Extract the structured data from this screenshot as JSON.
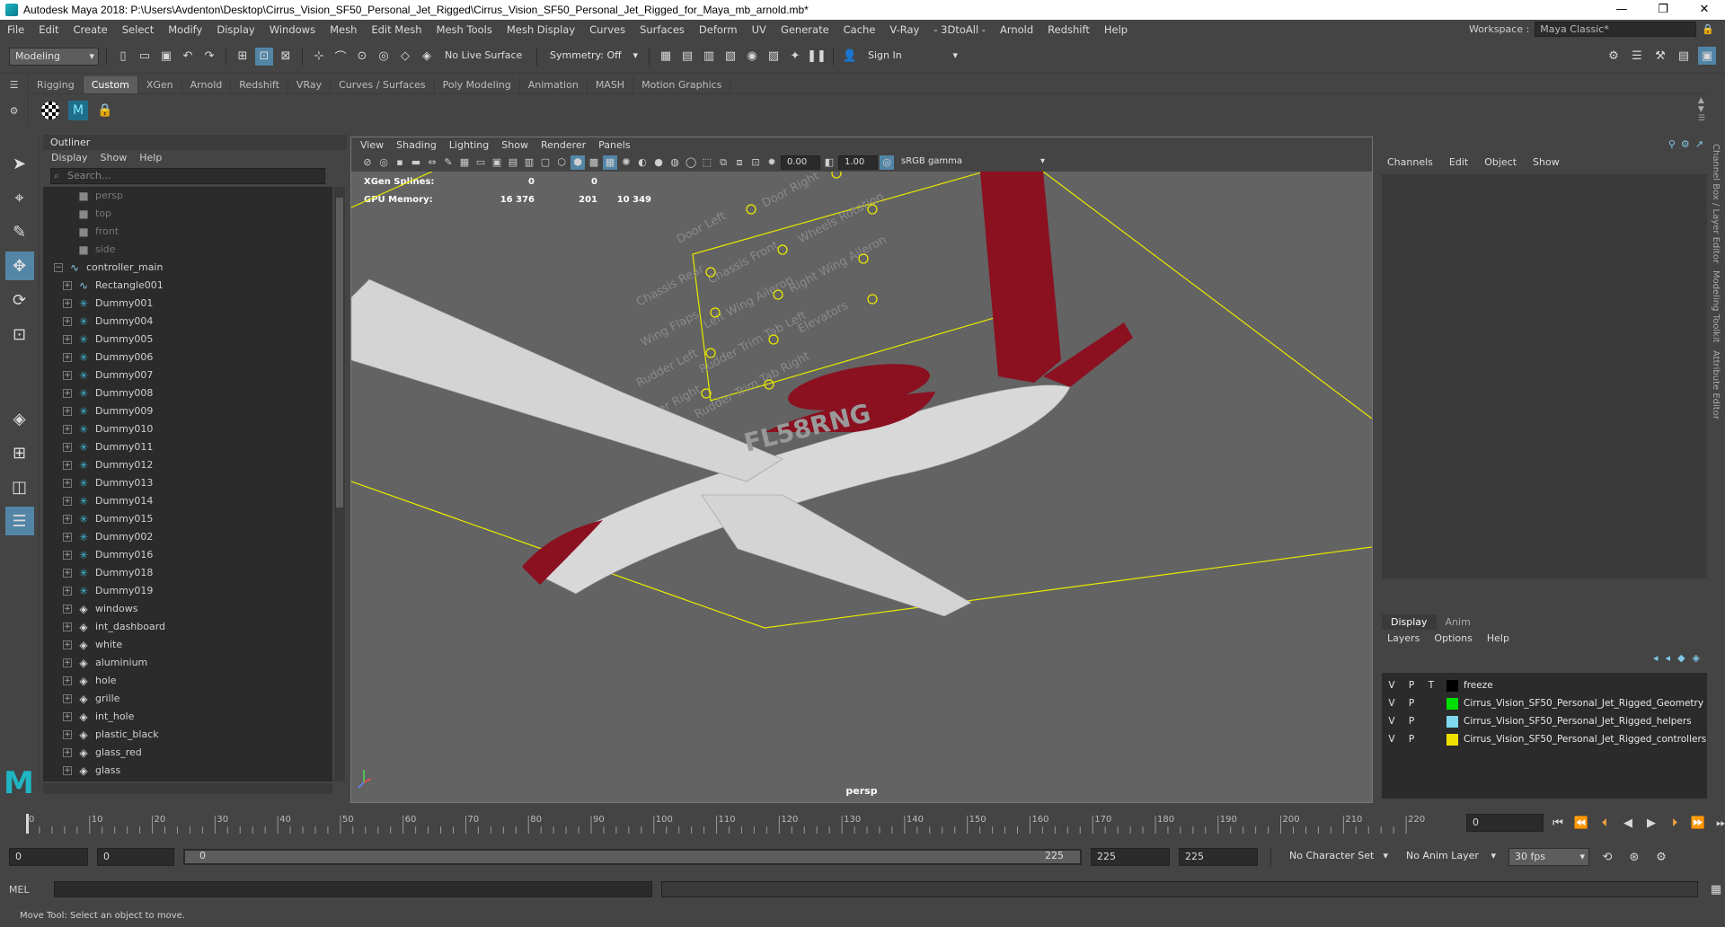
{
  "title": "Autodesk Maya 2018: P:\\Users\\Avdenton\\Desktop\\Cirrus_Vision_SF50_Personal_Jet_Rigged\\Cirrus_Vision_SF50_Personal_Jet_Rigged_for_Maya_mb_arnold.mb*",
  "menu": [
    "File",
    "Edit",
    "Create",
    "Select",
    "Modify",
    "Display",
    "Windows",
    "Mesh",
    "Edit Mesh",
    "Mesh Tools",
    "Mesh Display",
    "Curves",
    "Surfaces",
    "Deform",
    "UV",
    "Generate",
    "Cache",
    "V-Ray",
    "- 3DtoAll -",
    "Arnold",
    "Redshift",
    "Help"
  ],
  "workspace": {
    "label": "Workspace :",
    "value": "Maya Classic*"
  },
  "status": {
    "menuset": "Modeling",
    "live_surface": "No Live Surface",
    "symmetry": "Symmetry: Off",
    "sign_in": "Sign In"
  },
  "shelf_tabs": [
    "Rigging",
    "Custom",
    "XGen",
    "Arnold",
    "Redshift",
    "VRay",
    "Curves / Surfaces",
    "Poly Modeling",
    "Animation",
    "MASH",
    "Motion Graphics"
  ],
  "shelf_active": "Custom",
  "outliner": {
    "title": "Outliner",
    "menu": [
      "Display",
      "Show",
      "Help"
    ],
    "search_placeholder": "Search...",
    "items": [
      {
        "label": "persp",
        "icon": "camera-icon",
        "dim": true,
        "indent": 1
      },
      {
        "label": "top",
        "icon": "camera-icon",
        "dim": true,
        "indent": 1
      },
      {
        "label": "front",
        "icon": "camera-icon",
        "dim": true,
        "indent": 1
      },
      {
        "label": "side",
        "icon": "camera-icon",
        "dim": true,
        "indent": 1
      },
      {
        "label": "controller_main",
        "icon": "curve-icon",
        "expand": "−",
        "indent": 0
      },
      {
        "label": "Rectangle001",
        "icon": "curve-icon",
        "expand": "+",
        "indent": 1
      },
      {
        "label": "Dummy001",
        "icon": "joint-icon",
        "expand": "+",
        "indent": 1
      },
      {
        "label": "Dummy004",
        "icon": "joint-icon",
        "expand": "+",
        "indent": 1
      },
      {
        "label": "Dummy005",
        "icon": "joint-icon",
        "expand": "+",
        "indent": 1
      },
      {
        "label": "Dummy006",
        "icon": "joint-icon",
        "expand": "+",
        "indent": 1
      },
      {
        "label": "Dummy007",
        "icon": "joint-icon",
        "expand": "+",
        "indent": 1
      },
      {
        "label": "Dummy008",
        "icon": "joint-icon",
        "expand": "+",
        "indent": 1
      },
      {
        "label": "Dummy009",
        "icon": "joint-icon",
        "expand": "+",
        "indent": 1
      },
      {
        "label": "Dummy010",
        "icon": "joint-icon",
        "expand": "+",
        "indent": 1
      },
      {
        "label": "Dummy011",
        "icon": "joint-icon",
        "expand": "+",
        "indent": 1
      },
      {
        "label": "Dummy012",
        "icon": "joint-icon",
        "expand": "+",
        "indent": 1
      },
      {
        "label": "Dummy013",
        "icon": "joint-icon",
        "expand": "+",
        "indent": 1
      },
      {
        "label": "Dummy014",
        "icon": "joint-icon",
        "expand": "+",
        "indent": 1
      },
      {
        "label": "Dummy015",
        "icon": "joint-icon",
        "expand": "+",
        "indent": 1
      },
      {
        "label": "Dummy002",
        "icon": "joint-icon",
        "expand": "+",
        "indent": 1
      },
      {
        "label": "Dummy016",
        "icon": "joint-icon",
        "expand": "+",
        "indent": 1
      },
      {
        "label": "Dummy018",
        "icon": "joint-icon",
        "expand": "+",
        "indent": 1
      },
      {
        "label": "Dummy019",
        "icon": "joint-icon",
        "expand": "+",
        "indent": 1
      },
      {
        "label": "windows",
        "icon": "set-icon",
        "expand": "+",
        "indent": 1
      },
      {
        "label": "int_dashboard",
        "icon": "set-icon",
        "expand": "+",
        "indent": 1
      },
      {
        "label": "white",
        "icon": "set-icon",
        "expand": "+",
        "indent": 1
      },
      {
        "label": "aluminium",
        "icon": "set-icon",
        "expand": "+",
        "indent": 1
      },
      {
        "label": "hole",
        "icon": "set-icon",
        "expand": "+",
        "indent": 1
      },
      {
        "label": "grille",
        "icon": "set-icon",
        "expand": "+",
        "indent": 1
      },
      {
        "label": "int_hole",
        "icon": "set-icon",
        "expand": "+",
        "indent": 1
      },
      {
        "label": "plastic_black",
        "icon": "set-icon",
        "expand": "+",
        "indent": 1
      },
      {
        "label": "glass_red",
        "icon": "set-icon",
        "expand": "+",
        "indent": 1
      },
      {
        "label": "glass",
        "icon": "set-icon",
        "expand": "+",
        "indent": 1
      }
    ]
  },
  "viewport": {
    "menu": [
      "View",
      "Shading",
      "Lighting",
      "Show",
      "Renderer",
      "Panels"
    ],
    "exposure": "0.00",
    "gamma": "1.00",
    "colorspace": "sRGB gamma",
    "hud": [
      {
        "label": "XGen Splines:",
        "a": "0",
        "b": "0",
        "c": ""
      },
      {
        "label": "GPU Memory:",
        "a": "16 376",
        "b": "201",
        "c": "10 349"
      }
    ],
    "camera": "persp",
    "ctrl_labels": [
      "Door Left",
      "Door Right",
      "Wheels Rotation",
      "Chassis Front",
      "Chassis Rear",
      "Right Wing Aileron",
      "Left Wing Aileron",
      "Wing Flaps",
      "Rudder Trim Tab Left",
      "Elevators",
      "Rudder Left",
      "Rudder Trim Tab Right",
      "Rudder Right"
    ],
    "tail_number": "FL58RNG"
  },
  "channelbox": {
    "menu": [
      "Channels",
      "Edit",
      "Object",
      "Show"
    ],
    "layer_tabs": [
      "Display",
      "Anim"
    ],
    "layer_menu": [
      "Layers",
      "Options",
      "Help"
    ],
    "layers": [
      {
        "v": "V",
        "p": "P",
        "t": "T",
        "color": "#000000",
        "name": "freeze"
      },
      {
        "v": "V",
        "p": "P",
        "t": "",
        "color": "#00e000",
        "name": "Cirrus_Vision_SF50_Personal_Jet_Rigged_Geometry"
      },
      {
        "v": "V",
        "p": "P",
        "t": "",
        "color": "#7fd8f0",
        "name": "Cirrus_Vision_SF50_Personal_Jet_Rigged_helpers"
      },
      {
        "v": "V",
        "p": "P",
        "t": "",
        "color": "#f0e000",
        "name": "Cirrus_Vision_SF50_Personal_Jet_Rigged_controllers"
      }
    ],
    "side_tabs": [
      "Channel Box / Layer Editor",
      "Modeling Toolkit",
      "Attribute Editor"
    ]
  },
  "timeline": {
    "ticks": [
      "0",
      "10",
      "20",
      "30",
      "40",
      "50",
      "60",
      "70",
      "80",
      "90",
      "100",
      "110",
      "120",
      "130",
      "140",
      "150",
      "160",
      "170",
      "180",
      "190",
      "200",
      "210",
      "220"
    ],
    "current_frame": "0",
    "range_start": "0",
    "range_start2": "0",
    "range_slider_start": "0",
    "range_slider_end": "225",
    "range_end": "225",
    "range_end2": "225",
    "character_set": "No Character Set",
    "anim_layer": "No Anim Layer",
    "fps": "30 fps"
  },
  "cmdline": {
    "label": "MEL"
  },
  "helpline": "Move Tool: Select an object to move.",
  "colors": {
    "accent": "#5285a6",
    "maya_teal": "#1fb6c4",
    "jet_red": "#8b1020",
    "bbox_yellow": "#e8e800"
  }
}
